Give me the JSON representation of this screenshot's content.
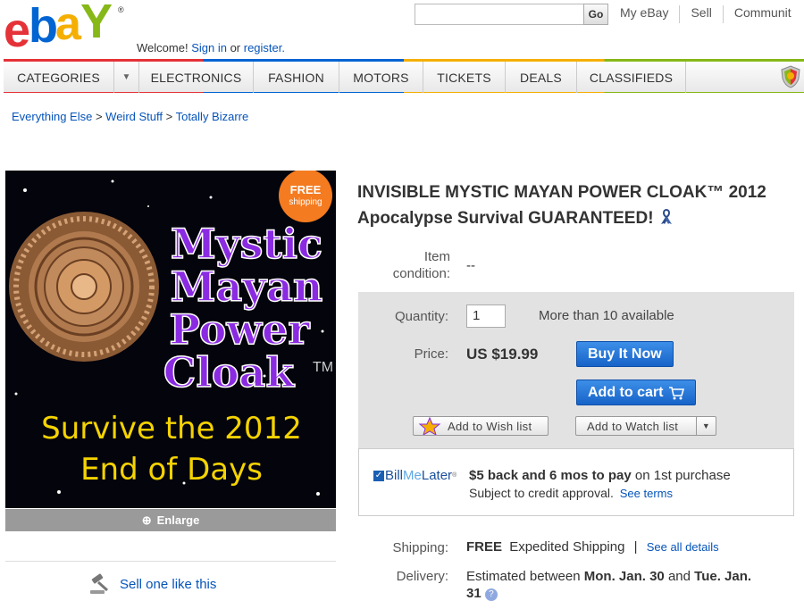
{
  "header": {
    "welcome_prefix": "Welcome!",
    "sign_in": "Sign in",
    "or_text": "or",
    "register": "register.",
    "go": "Go",
    "links": [
      "My eBay",
      "Sell",
      "Communit"
    ]
  },
  "nav": {
    "categories": "CATEGORIES",
    "items": [
      "ELECTRONICS",
      "FASHION",
      "MOTORS",
      "TICKETS",
      "DEALS",
      "CLASSIFIEDS"
    ]
  },
  "breadcrumb": [
    "Everything Else",
    "Weird Stuff",
    "Totally Bizarre"
  ],
  "image": {
    "badge_line1": "FREE",
    "badge_line2": "shipping",
    "line1": "Mystic",
    "line2": "Mayan",
    "line3": "Power",
    "line4": "Cloak",
    "tm": "TM",
    "survive1": "Survive the 2012",
    "survive2": "End of Days",
    "enlarge": "Enlarge"
  },
  "sell_one": "Sell one like this",
  "listing": {
    "title": "INVISIBLE MYSTIC MAYAN POWER CLOAK™ 2012 Apocalypse Survival GUARANTEED!",
    "condition_label_1": "Item",
    "condition_label_2": "condition:",
    "condition_value": "--",
    "quantity_label": "Quantity:",
    "quantity_value": "1",
    "available": "More than 10 available",
    "price_label": "Price:",
    "price": "US $19.99",
    "buy_now": "Buy It Now",
    "add_cart": "Add to cart",
    "wish": "Add to Wish list",
    "watch": "Add to Watch list",
    "bml_logo_a": "Bill",
    "bml_logo_b": "Me",
    "bml_logo_c": "Later",
    "bml_bold": "$5 back and 6 mos to pay",
    "bml_rest": "on 1st purchase",
    "bml_line2": "Subject to credit approval.",
    "see_terms": "See terms",
    "shipping_label": "Shipping:",
    "shipping_free": "FREE",
    "shipping_type": "Expedited Shipping",
    "see_details": "See all details",
    "delivery_label": "Delivery:",
    "delivery_prefix": "Estimated between",
    "delivery_date1": "Mon. Jan. 30",
    "delivery_and": "and",
    "delivery_date2": "Tue. Jan.",
    "delivery_date3": "31"
  }
}
